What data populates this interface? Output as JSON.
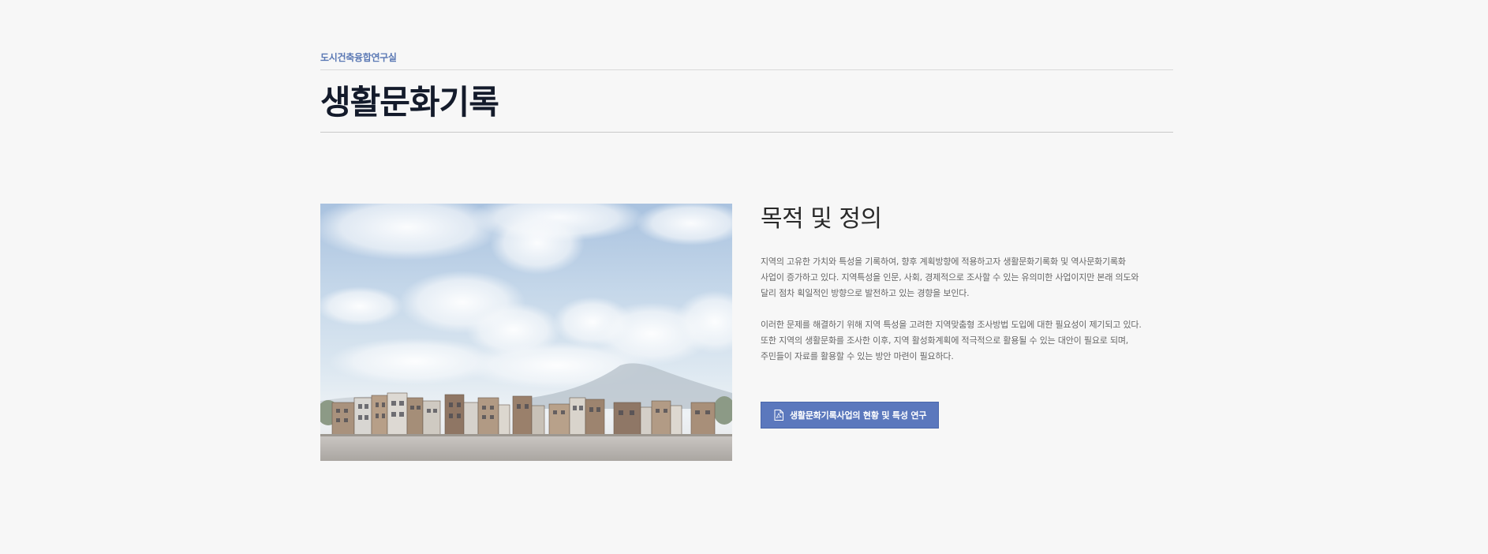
{
  "header": {
    "lab_name": "도시건축융합연구실",
    "title": "생활문화기록"
  },
  "hero_image": {
    "description_name": "village-streetscape-illustration"
  },
  "section": {
    "title": "목적 및 정의",
    "paragraph1_lines": [
      "지역의 고유한 가치와 특성을 기록하여, 향후 계획방향에 적용하고자 생활문화기록화 및 역사문화기록화",
      "사업이 증가하고 있다. 지역특성을 인문, 사회, 경제적으로 조사할 수 있는 유의미한 사업이지만 본래 의도와",
      "달리 점차 획일적인 방향으로 발전하고 있는 경향을 보인다."
    ],
    "paragraph2_lines": [
      "이러한 문제를 해결하기 위해 지역 특성을 고려한 지역맞춤형 조사방법 도입에 대한 필요성이 제기되고 있다.",
      "또한 지역의 생활문화를 조사한 이후, 지역 활성화계획에 적극적으로 활용될 수 있는 대안이 필요로 되며,",
      "주민들이 자료를 활용할 수 있는 방안 마련이 필요하다."
    ],
    "button_label": "생활문화기록사업의 현황 및 특성 연구",
    "button_icon": "pdf-file-icon"
  },
  "colors": {
    "background": "#f7f7f7",
    "accent": "#5a78b4",
    "button": "#5b78bd",
    "title": "#141b2b"
  }
}
